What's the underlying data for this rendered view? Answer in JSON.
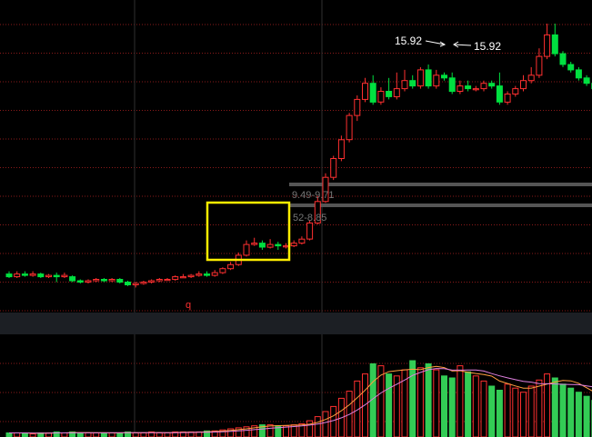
{
  "colors": {
    "up": "#ff3030",
    "down": "#00e040",
    "volume_up": "#ff3030",
    "volume_down": "#33cc55",
    "grid": "#8a1a1a",
    "grid_vertical": "#303030",
    "divider_band": "#1c1f24",
    "highlight_box": "#ffee00",
    "level_bar": "#555555",
    "text": "#ffffff",
    "muted_text": "#777777",
    "ma_orange": "#ff9f40",
    "ma_pink": "#e080e0"
  },
  "annotations": {
    "peak_left": "15.92",
    "peak_right": "15.92",
    "level_upper": "9.49-9.71",
    "level_lower": "52-8.85",
    "marker": "q"
  },
  "chart_data": [
    {
      "type": "candlestick",
      "title": "",
      "price_range": [
        5.2,
        16.8
      ],
      "highlight_box": {
        "from_index": 33,
        "to_index": 45
      },
      "levels": [
        {
          "label": "9.49-9.71",
          "value": 9.6
        },
        {
          "label": "52-8.85",
          "value": 8.85
        }
      ],
      "peak": {
        "index": 69,
        "value": 15.92
      },
      "candles": [
        [
          6.6,
          6.5,
          6.7,
          6.45
        ],
        [
          6.5,
          6.6,
          6.7,
          6.45
        ],
        [
          6.6,
          6.55,
          6.7,
          6.5
        ],
        [
          6.55,
          6.6,
          6.7,
          6.5
        ],
        [
          6.6,
          6.5,
          6.65,
          6.45
        ],
        [
          6.5,
          6.55,
          6.6,
          6.45
        ],
        [
          6.55,
          6.5,
          6.65,
          6.3
        ],
        [
          6.5,
          6.55,
          6.65,
          6.45
        ],
        [
          6.5,
          6.35,
          6.55,
          6.3
        ],
        [
          6.35,
          6.3,
          6.4,
          6.25
        ],
        [
          6.3,
          6.35,
          6.4,
          6.25
        ],
        [
          6.35,
          6.4,
          6.45,
          6.3
        ],
        [
          6.4,
          6.35,
          6.45,
          6.3
        ],
        [
          6.35,
          6.4,
          6.45,
          6.3
        ],
        [
          6.4,
          6.3,
          6.45,
          6.25
        ],
        [
          6.3,
          6.2,
          6.35,
          6.15
        ],
        [
          6.2,
          6.25,
          6.3,
          6.1
        ],
        [
          6.25,
          6.3,
          6.35,
          6.2
        ],
        [
          6.3,
          6.35,
          6.4,
          6.25
        ],
        [
          6.35,
          6.4,
          6.45,
          6.3
        ],
        [
          6.4,
          6.4,
          6.45,
          6.35
        ],
        [
          6.4,
          6.5,
          6.55,
          6.35
        ],
        [
          6.5,
          6.5,
          6.6,
          6.45
        ],
        [
          6.5,
          6.55,
          6.6,
          6.45
        ],
        [
          6.55,
          6.6,
          6.7,
          6.5
        ],
        [
          6.6,
          6.55,
          6.7,
          6.5
        ],
        [
          6.55,
          6.65,
          6.75,
          6.5
        ],
        [
          6.65,
          6.8,
          6.85,
          6.6
        ],
        [
          6.8,
          6.95,
          7.05,
          6.75
        ],
        [
          6.95,
          7.3,
          7.4,
          6.9
        ],
        [
          7.3,
          7.7,
          7.85,
          7.25
        ],
        [
          7.7,
          7.75,
          7.95,
          7.65
        ],
        [
          7.75,
          7.6,
          7.85,
          7.5
        ],
        [
          7.6,
          7.7,
          7.9,
          7.55
        ],
        [
          7.7,
          7.65,
          7.8,
          7.5
        ],
        [
          7.65,
          7.65,
          7.75,
          7.55
        ],
        [
          7.65,
          7.75,
          7.85,
          7.6
        ],
        [
          7.75,
          7.9,
          8.0,
          7.7
        ],
        [
          7.9,
          8.5,
          8.6,
          7.85
        ],
        [
          8.5,
          9.3,
          9.5,
          8.45
        ],
        [
          9.3,
          10.2,
          10.35,
          9.25
        ],
        [
          10.2,
          10.9,
          11.0,
          10.1
        ],
        [
          10.9,
          11.6,
          11.75,
          10.8
        ],
        [
          11.6,
          12.5,
          12.6,
          11.5
        ],
        [
          12.5,
          13.1,
          13.25,
          12.3
        ],
        [
          13.1,
          13.7,
          13.9,
          13.0
        ],
        [
          13.7,
          13.0,
          14.0,
          12.9
        ],
        [
          13.0,
          13.4,
          13.55,
          12.9
        ],
        [
          13.4,
          13.2,
          13.9,
          13.1
        ],
        [
          13.2,
          13.5,
          14.1,
          13.1
        ],
        [
          13.5,
          13.8,
          14.2,
          13.4
        ],
        [
          13.8,
          13.6,
          14.0,
          13.5
        ],
        [
          13.6,
          14.2,
          14.3,
          13.5
        ],
        [
          14.2,
          13.6,
          14.4,
          13.5
        ],
        [
          13.6,
          14.0,
          14.2,
          13.5
        ],
        [
          14.0,
          13.9,
          14.1,
          13.8
        ],
        [
          13.9,
          13.4,
          14.1,
          13.3
        ],
        [
          13.4,
          13.6,
          13.8,
          13.3
        ],
        [
          13.6,
          13.5,
          13.8,
          13.4
        ],
        [
          13.5,
          13.5,
          13.6,
          13.4
        ],
        [
          13.5,
          13.7,
          13.8,
          13.4
        ],
        [
          13.7,
          13.6,
          13.8,
          13.5
        ],
        [
          13.6,
          13.0,
          14.1,
          12.9
        ],
        [
          13.0,
          13.3,
          13.4,
          12.9
        ],
        [
          13.3,
          13.5,
          13.6,
          13.2
        ],
        [
          13.5,
          13.8,
          14.0,
          13.4
        ],
        [
          13.8,
          14.0,
          14.3,
          13.7
        ],
        [
          14.0,
          14.7,
          15.0,
          13.9
        ],
        [
          14.7,
          15.5,
          15.92,
          14.6
        ],
        [
          15.5,
          14.8,
          15.92,
          14.7
        ],
        [
          14.8,
          14.4,
          14.9,
          14.3
        ],
        [
          14.4,
          14.2,
          14.5,
          14.1
        ],
        [
          14.2,
          13.9,
          14.3,
          13.8
        ],
        [
          13.9,
          13.7,
          14.0,
          13.6
        ],
        [
          13.7,
          13.5,
          13.9,
          13.4
        ]
      ]
    },
    {
      "type": "bar",
      "title": "",
      "ylim": [
        0,
        100
      ],
      "volumes": [
        4,
        4,
        4,
        3,
        4,
        4,
        5,
        4,
        5,
        4,
        4,
        4,
        4,
        4,
        4,
        5,
        4,
        4,
        5,
        4,
        4,
        5,
        5,
        5,
        5,
        6,
        6,
        7,
        8,
        9,
        10,
        11,
        12,
        12,
        11,
        11,
        12,
        13,
        16,
        20,
        25,
        30,
        38,
        45,
        55,
        62,
        72,
        70,
        62,
        60,
        66,
        75,
        68,
        72,
        66,
        60,
        58,
        70,
        64,
        60,
        55,
        50,
        46,
        52,
        48,
        44,
        50,
        56,
        62,
        58,
        52,
        48,
        44,
        40,
        36
      ]
    }
  ]
}
